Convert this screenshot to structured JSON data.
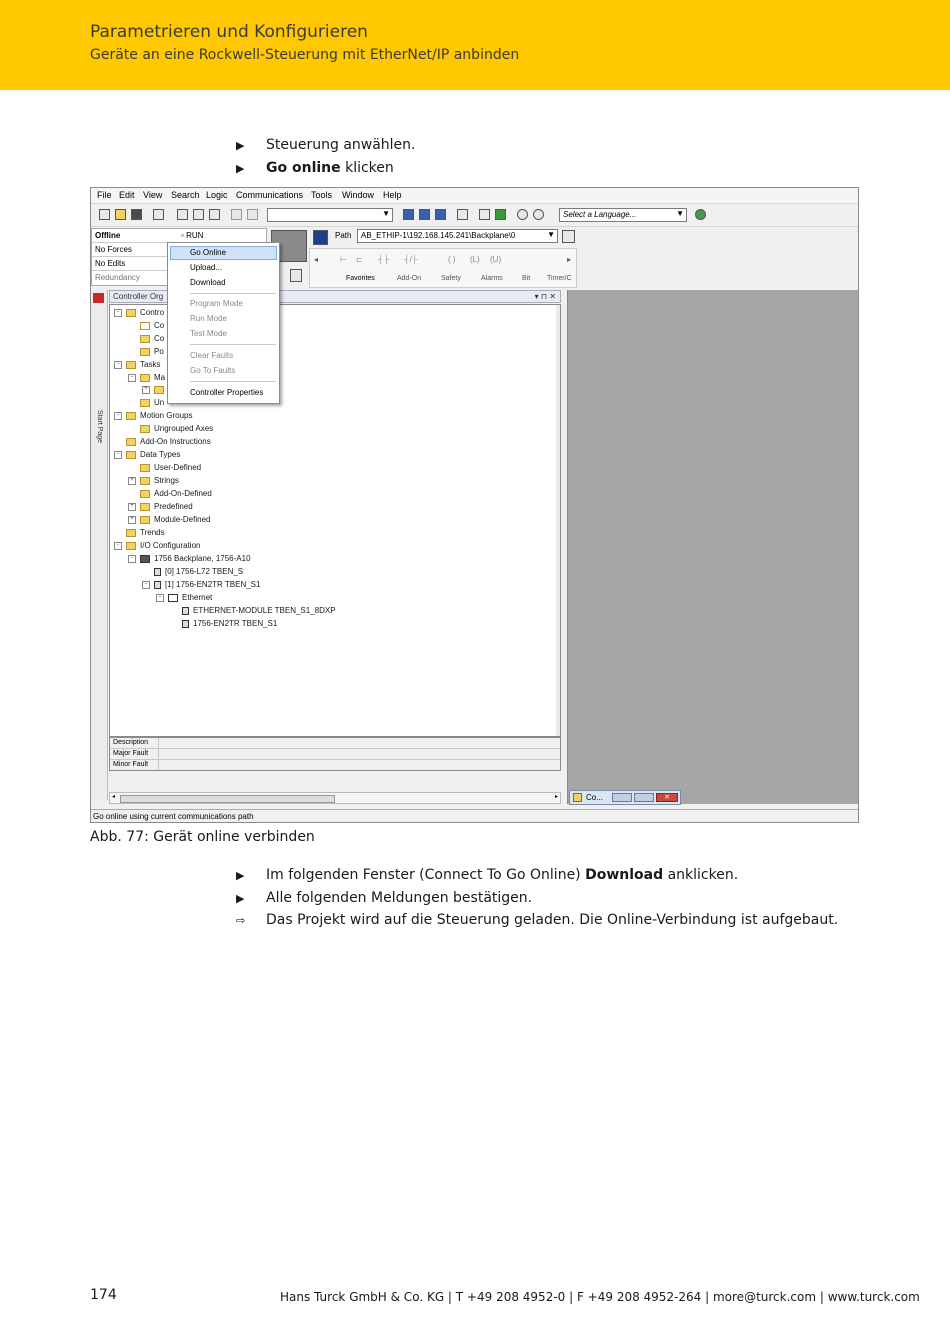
{
  "header": {
    "title": "Parametrieren und Konfigurieren",
    "subtitle": "Geräte an eine Rockwell-Steuerung mit EtherNet/IP anbinden",
    "color": "#ffc800"
  },
  "steps_top": [
    {
      "marker": "▶",
      "text": "Steuerung anwählen.",
      "bold": "",
      "after": ""
    },
    {
      "marker": "▶",
      "text": "",
      "bold": "Go online",
      "after": " klicken"
    }
  ],
  "screenshot": {
    "menu": [
      "File",
      "Edit",
      "View",
      "Search",
      "Logic",
      "Communications",
      "Tools",
      "Window",
      "Help"
    ],
    "language_combo": "Select a Language...",
    "status": {
      "offline": "Offline",
      "no_forces": "No Forces",
      "no_edits": "No Edits",
      "redundancy": "Redundancy",
      "run": "RUN"
    },
    "path_label": "Path",
    "path_value": "AB_ETHIP-1\\192.168.145.241\\Backplane\\0",
    "instruction_tabs": [
      "Favorites",
      "Add-On",
      "Safety",
      "Alarms",
      "Bit",
      "Timer/C"
    ],
    "context_menu": {
      "items": [
        {
          "label": "Go Online",
          "disabled": false
        },
        {
          "label": "Upload...",
          "disabled": false
        },
        {
          "label": "Download",
          "disabled": false
        },
        {
          "label": "Program Mode",
          "disabled": true
        },
        {
          "label": "Run Mode",
          "disabled": true
        },
        {
          "label": "Test Mode",
          "disabled": true
        },
        {
          "label": "Clear Faults",
          "disabled": true
        },
        {
          "label": "Go To Faults",
          "disabled": true
        },
        {
          "label": "Controller Properties",
          "disabled": false
        }
      ]
    },
    "start_page_tab": "Start Page",
    "organizer_title": "Controller Org",
    "tree": [
      "Contro",
      "Co",
      "Co",
      "Po",
      "Tasks",
      "Ma",
      "",
      "Un",
      "Motion Groups",
      "Ungrouped Axes",
      "Add-On Instructions",
      "Data Types",
      "User-Defined",
      "Strings",
      "Add-On-Defined",
      "Predefined",
      "Module-Defined",
      "Trends",
      "I/O Configuration",
      "1756 Backplane, 1756-A10",
      "[0] 1756-L72 TBEN_S",
      "[1] 1756-EN2TR TBEN_S1",
      "Ethernet",
      "ETHERNET-MODULE TBEN_S1_8DXP",
      "1756-EN2TR TBEN_S1"
    ],
    "desc_rows": [
      "Description",
      "Major Fault",
      "Minor Fault"
    ],
    "min_window": "Co...",
    "statusbar": "Go online using current communications path"
  },
  "caption": "Abb. 77: Gerät online verbinden",
  "steps_bottom": [
    {
      "marker": "▶",
      "text": "Im folgenden Fenster (Connect To Go Online) ",
      "bold": "Download",
      "after": " anklicken."
    },
    {
      "marker": "▶",
      "text": "Alle folgenden Meldungen bestätigen.",
      "bold": "",
      "after": ""
    },
    {
      "marker": "⇨",
      "text": "Das Projekt wird auf die Steuerung geladen. Die Online-Verbindung ist aufgebaut.",
      "bold": "",
      "after": ""
    }
  ],
  "footer": {
    "page": "174",
    "company": "Hans Turck GmbH & Co. KG | T +49 208 4952-0 | F +49 208 4952-264 | more@turck.com | www.turck.com"
  }
}
